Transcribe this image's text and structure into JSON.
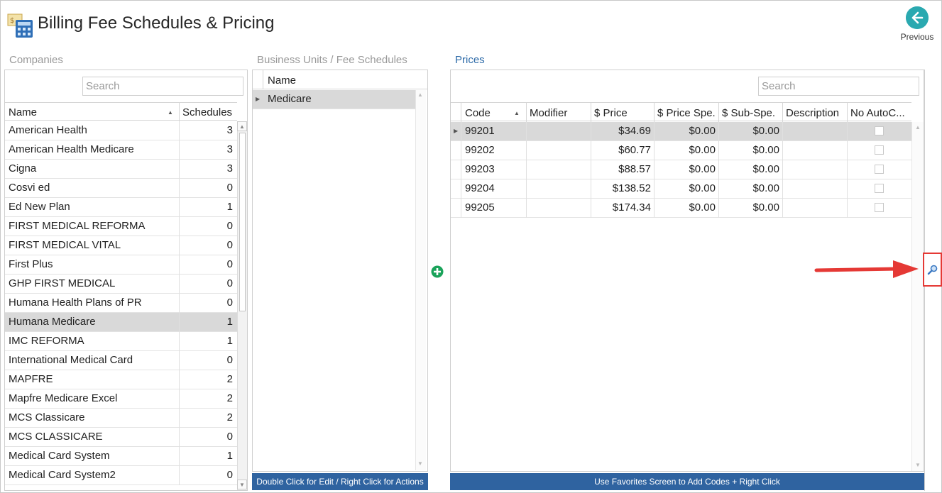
{
  "header": {
    "title": "Billing Fee Schedules & Pricing",
    "previous_label": "Previous"
  },
  "sections": {
    "companies": "Companies",
    "business_units": "Business Units / Fee Schedules",
    "prices": "Prices"
  },
  "companies": {
    "search_placeholder": "Search",
    "columns": [
      "Name",
      "Schedules"
    ],
    "rows": [
      {
        "name": "American Health",
        "schedules": "3"
      },
      {
        "name": "American Health Medicare",
        "schedules": "3"
      },
      {
        "name": "Cigna",
        "schedules": "3"
      },
      {
        "name": "Cosvi ed",
        "schedules": "0"
      },
      {
        "name": "Ed New Plan",
        "schedules": "1"
      },
      {
        "name": "FIRST MEDICAL REFORMA",
        "schedules": "0"
      },
      {
        "name": "FIRST MEDICAL VITAL",
        "schedules": "0"
      },
      {
        "name": "First Plus",
        "schedules": "0"
      },
      {
        "name": "GHP FIRST MEDICAL",
        "schedules": "0"
      },
      {
        "name": "Humana Health Plans of PR",
        "schedules": "0"
      },
      {
        "name": "Humana Medicare",
        "schedules": "1"
      },
      {
        "name": "IMC REFORMA",
        "schedules": "1"
      },
      {
        "name": "International Medical Card",
        "schedules": "0"
      },
      {
        "name": "MAPFRE",
        "schedules": "2"
      },
      {
        "name": "Mapfre Medicare Excel",
        "schedules": "2"
      },
      {
        "name": "MCS Classicare",
        "schedules": "2"
      },
      {
        "name": "MCS CLASSICARE",
        "schedules": "0"
      },
      {
        "name": "Medical Card System",
        "schedules": "1"
      },
      {
        "name": "Medical Card System2",
        "schedules": "0"
      }
    ],
    "selected_index": 10
  },
  "business_units": {
    "column": "Name",
    "rows": [
      "Medicare"
    ],
    "footer": "Double Click for Edit / Right Click for Actions"
  },
  "prices": {
    "search_placeholder": "Search",
    "columns": [
      "Code",
      "Modifier",
      "$ Price",
      "$ Price Spe.",
      "$ Sub-Spe.",
      "Description",
      "No AutoC..."
    ],
    "rows": [
      {
        "code": "99201",
        "modifier": "",
        "price": "$34.69",
        "price_spe": "$0.00",
        "sub_spe": "$0.00",
        "description": "",
        "no_autoc": false
      },
      {
        "code": "99202",
        "modifier": "",
        "price": "$60.77",
        "price_spe": "$0.00",
        "sub_spe": "$0.00",
        "description": "",
        "no_autoc": false
      },
      {
        "code": "99203",
        "modifier": "",
        "price": "$88.57",
        "price_spe": "$0.00",
        "sub_spe": "$0.00",
        "description": "",
        "no_autoc": false
      },
      {
        "code": "99204",
        "modifier": "",
        "price": "$138.52",
        "price_spe": "$0.00",
        "sub_spe": "$0.00",
        "description": "",
        "no_autoc": false
      },
      {
        "code": "99205",
        "modifier": "",
        "price": "$174.34",
        "price_spe": "$0.00",
        "sub_spe": "$0.00",
        "description": "",
        "no_autoc": false
      }
    ],
    "footer": "Use Favorites Screen to Add Codes + Right Click"
  },
  "colors": {
    "accent": "#2f63a0",
    "add": "#1aa35a",
    "annotation": "#e53935",
    "previous": "#2aa9b0"
  }
}
